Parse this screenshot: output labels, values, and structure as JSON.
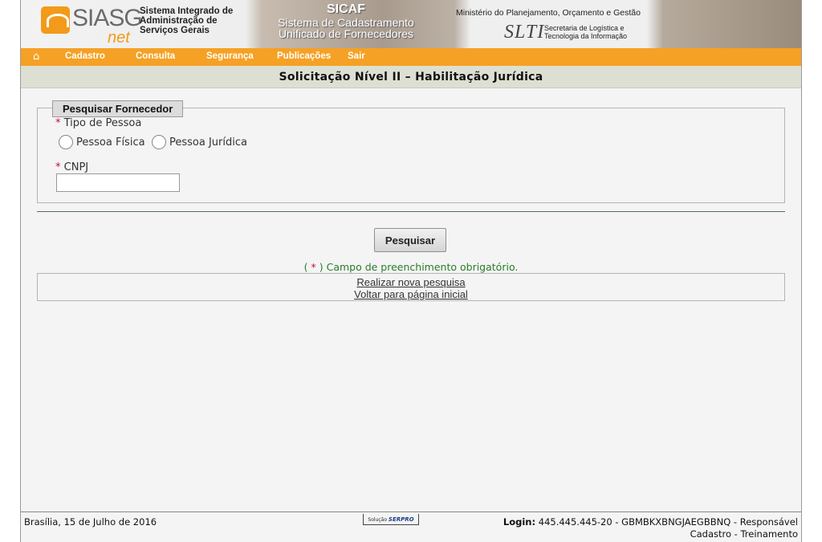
{
  "banner": {
    "siasg_logo": "SIASG",
    "siasg_logo_net": "net",
    "siasg_text": [
      "Sistema Integrado de",
      "Administração de",
      "Serviços Gerais"
    ],
    "sicaf_title": "SICAF",
    "sicaf_sub_1": "Sistema de Cadastramento",
    "sicaf_sub_2": "Unificado de Fornecedores",
    "ministerio": "Ministério do Planejamento, Orçamento e Gestão",
    "slti_logo": "SLTI",
    "slti_text_1": "Secretaria de Logística e",
    "slti_text_2": "Tecnologia da Informação"
  },
  "menu": {
    "items": [
      "Cadastro",
      "Consulta",
      "Segurança",
      "Publicações",
      "Sair"
    ]
  },
  "page_title": "Solicitação Nível II – Habilitação Jurídica",
  "form": {
    "legend": "Pesquisar Fornecedor",
    "required_mark": "*",
    "tipo_label": "Tipo de Pessoa",
    "radio_fisica": "Pessoa Física",
    "radio_juridica": "Pessoa Jurídica",
    "cnpj_label": "CNPJ",
    "cnpj_value": "",
    "search_button": "Pesquisar",
    "obrig_open": "( ",
    "obrig_close": " ) Campo de preenchimento obrigatório."
  },
  "links": {
    "nova_pesquisa": "Realizar nova pesquisa",
    "voltar": "Voltar para página inicial"
  },
  "footer": {
    "date": "Brasília, 15 de Julho de 2016",
    "serpro_label": "Solução",
    "serpro_brand": "SERPRO",
    "login_label": "Login:",
    "login_value": "445.445.445-20 - GBMBKXBNGJAEGBBNQ - Responsável",
    "login_line2": "Cadastro - Treinamento"
  },
  "colors": {
    "menu_bg": "#f5a125",
    "title_bar_bg": "#dedfd3",
    "required": "#c8102e",
    "obrig_text": "#2a7a2a"
  }
}
